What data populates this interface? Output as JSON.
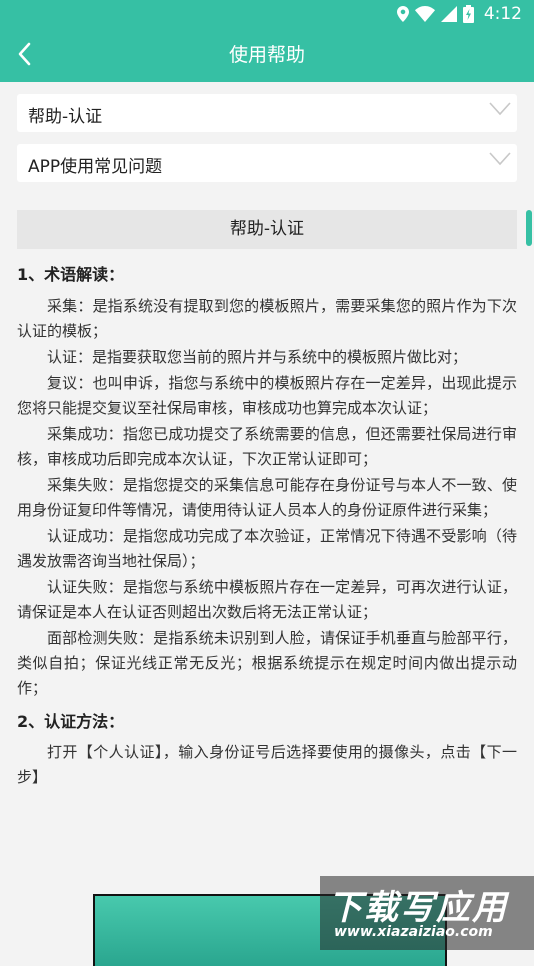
{
  "status_bar": {
    "time": "4:12",
    "icons": [
      "location-icon",
      "wifi-icon",
      "signal-icon",
      "battery-icon"
    ]
  },
  "header": {
    "title": "使用帮助",
    "back_icon": "back-arrow-icon"
  },
  "selectors": [
    {
      "label": "帮助-认证"
    },
    {
      "label": "APP使用常见问题"
    }
  ],
  "section": {
    "title": "帮助-认证",
    "heading1": "1、术语解读：",
    "terms": [
      "采集：是指系统没有提取到您的模板照片，需要采集您的照片作为下次认证的模板；",
      "认证：是指要获取您当前的照片并与系统中的模板照片做比对；",
      "复议：也叫申诉，指您与系统中的模板照片存在一定差异，出现此提示您将只能提交复议至社保局审核，审核成功也算完成本次认证；",
      "采集成功：指您已成功提交了系统需要的信息，但还需要社保局进行审核，审核成功后即完成本次认证，下次正常认证即可；",
      "采集失败：是指您提交的采集信息可能存在身份证号与本人不一致、使用身份证复印件等情况，请使用待认证人员本人的身份证原件进行采集；",
      "认证成功：是指您成功完成了本次验证，正常情况下待遇不受影响（待遇发放需咨询当地社保局）；",
      "认证失败：是指您与系统中模板照片存在一定差异，可再次进行认证，请保证是本人在认证否则超出次数后将无法正常认证；",
      "面部检测失败：是指系统未识别到人脸，请保证手机垂直与脸部平行，类似自拍；保证光线正常无反光；根据系统提示在规定时间内做出提示动作；"
    ],
    "heading2": "2、认证方法：",
    "method": "打开【个人认证】，输入身份证号后选择要使用的摄像头，点击【下一步】"
  },
  "watermark": {
    "text": "下载写应用",
    "url": "www.xiazaiziao.com"
  },
  "colors": {
    "accent": "#36c0a4",
    "background": "#f3f3f3",
    "section_header_bg": "#e6e6e6"
  }
}
